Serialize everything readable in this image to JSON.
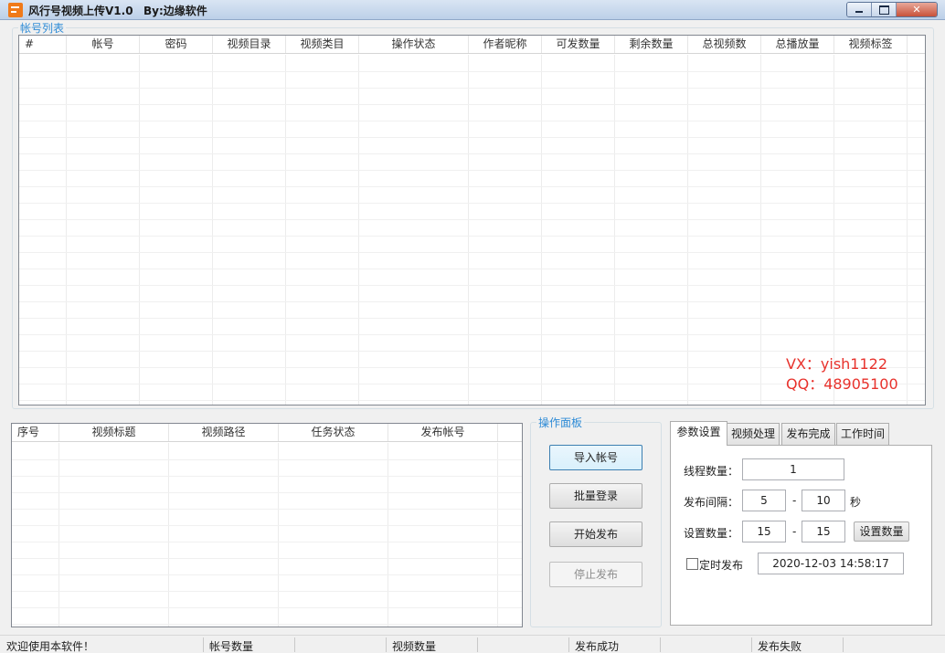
{
  "window": {
    "title": "风行号视频上传V1.0",
    "author": "By:边缘软件"
  },
  "account_group": {
    "title": "帐号列表",
    "columns": [
      "#",
      "帐号",
      "密码",
      "视频目录",
      "视频类目",
      "操作状态",
      "作者昵称",
      "可发数量",
      "剩余数量",
      "总视频数",
      "总播放量",
      "视频标签"
    ],
    "watermark_vx": "VX：yish1122",
    "watermark_qq": "QQ：48905100"
  },
  "task_list": {
    "columns": [
      "序号",
      "视频标题",
      "视频路径",
      "任务状态",
      "发布帐号"
    ]
  },
  "op_panel": {
    "title": "操作面板",
    "import_label": "导入帐号",
    "login_label": "批量登录",
    "start_label": "开始发布",
    "stop_label": "停止发布"
  },
  "tabs": [
    "参数设置",
    "视频处理",
    "发布完成",
    "工作时间"
  ],
  "params": {
    "thread_label": "线程数量：",
    "thread_value": "1",
    "interval_label": "发布间隔：",
    "interval_min": "5",
    "interval_sep": "-",
    "interval_max": "10",
    "interval_unit": "秒",
    "count_label": "设置数量：",
    "count_min": "15",
    "count_sep": "-",
    "count_max": "15",
    "count_button": "设置数量",
    "timed_label": "定时发布",
    "timed_checked": false,
    "timed_value": "2020-12-03 14:58:17"
  },
  "statusbar": {
    "welcome": "欢迎使用本软件！",
    "accounts": "帐号数量",
    "videos": "视频数量",
    "success": "发布成功",
    "failed": "发布失败"
  }
}
